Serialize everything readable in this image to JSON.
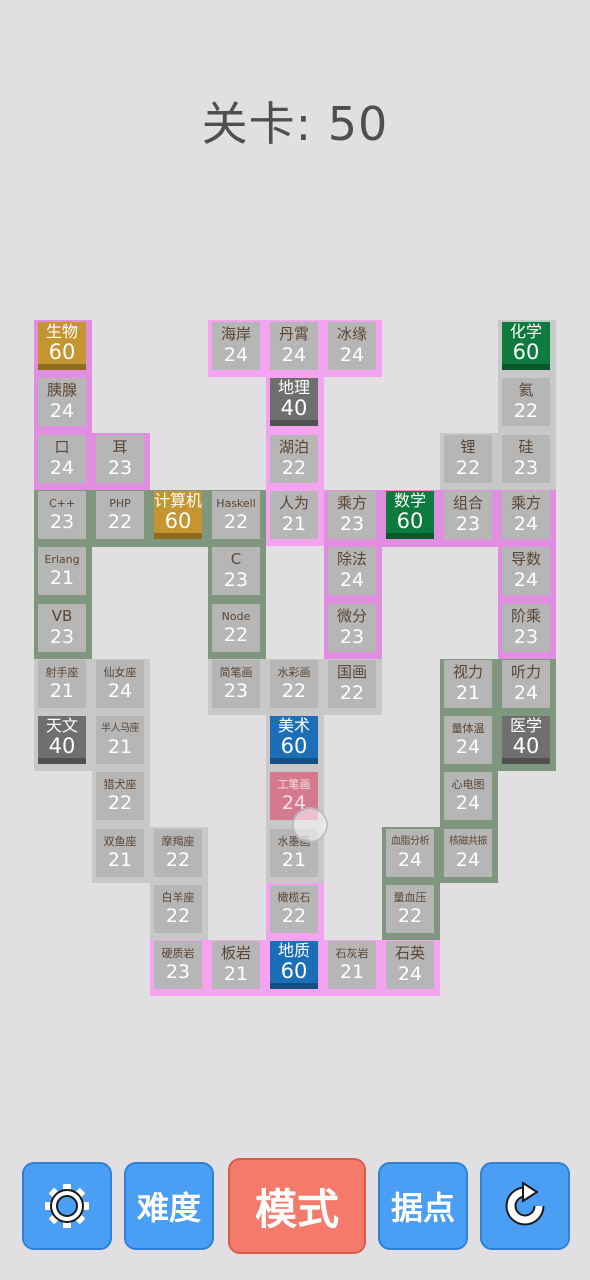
{
  "level": {
    "label": "关卡: 50"
  },
  "colors": {
    "background": "#e1dfe2",
    "tile": "#b6b6b6",
    "pink_region": "#df8ee0",
    "green_region": "#7f977f",
    "light_region": "#c8c8c8",
    "gold": "#c59531",
    "dark_green": "#0d7a3e",
    "blue": "#1c6fb6",
    "gray_big": "#6f6f6f",
    "button": "#4a9ff5",
    "mode_button": "#f47a6c"
  },
  "tiles": [
    {
      "name": "生物",
      "value": "60",
      "col": 0,
      "row": 0,
      "kind": "gold"
    },
    {
      "name": "海岸",
      "value": "24",
      "col": 3,
      "row": 0
    },
    {
      "name": "丹霄",
      "value": "24",
      "col": 4,
      "row": 0
    },
    {
      "name": "冰缘",
      "value": "24",
      "col": 5,
      "row": 0
    },
    {
      "name": "化学",
      "value": "60",
      "col": 8,
      "row": 0,
      "kind": "green"
    },
    {
      "name": "胰腺",
      "value": "24",
      "col": 0,
      "row": 1
    },
    {
      "name": "地理",
      "value": "40",
      "col": 4,
      "row": 1,
      "kind": "gray"
    },
    {
      "name": "氦",
      "value": "22",
      "col": 8,
      "row": 1
    },
    {
      "name": "口",
      "value": "24",
      "col": 0,
      "row": 2
    },
    {
      "name": "耳",
      "value": "23",
      "col": 1,
      "row": 2
    },
    {
      "name": "湖泊",
      "value": "22",
      "col": 4,
      "row": 2
    },
    {
      "name": "锂",
      "value": "22",
      "col": 7,
      "row": 2
    },
    {
      "name": "硅",
      "value": "23",
      "col": 8,
      "row": 2
    },
    {
      "name": "C++",
      "value": "23",
      "col": 0,
      "row": 3,
      "size": "s"
    },
    {
      "name": "PHP",
      "value": "22",
      "col": 1,
      "row": 3,
      "size": "s"
    },
    {
      "name": "计算机",
      "value": "60",
      "col": 2,
      "row": 3,
      "kind": "gold",
      "size": "s"
    },
    {
      "name": "Haskell",
      "value": "22",
      "col": 3,
      "row": 3,
      "size": "s"
    },
    {
      "name": "人为",
      "value": "21",
      "col": 4,
      "row": 3
    },
    {
      "name": "乘方",
      "value": "23",
      "col": 5,
      "row": 3
    },
    {
      "name": "数学",
      "value": "60",
      "col": 6,
      "row": 3,
      "kind": "green"
    },
    {
      "name": "组合",
      "value": "23",
      "col": 7,
      "row": 3
    },
    {
      "name": "乘方",
      "value": "24",
      "col": 8,
      "row": 3
    },
    {
      "name": "Erlang",
      "value": "21",
      "col": 0,
      "row": 4,
      "size": "s"
    },
    {
      "name": "C",
      "value": "23",
      "col": 3,
      "row": 4
    },
    {
      "name": "除法",
      "value": "24",
      "col": 5,
      "row": 4
    },
    {
      "name": "导数",
      "value": "24",
      "col": 8,
      "row": 4
    },
    {
      "name": "VB",
      "value": "23",
      "col": 0,
      "row": 5
    },
    {
      "name": "Node",
      "value": "22",
      "col": 3,
      "row": 5,
      "size": "s"
    },
    {
      "name": "微分",
      "value": "23",
      "col": 5,
      "row": 5
    },
    {
      "name": "阶乘",
      "value": "23",
      "col": 8,
      "row": 5
    },
    {
      "name": "射手座",
      "value": "21",
      "col": 0,
      "row": 6,
      "size": "s"
    },
    {
      "name": "仙女座",
      "value": "24",
      "col": 1,
      "row": 6,
      "size": "s"
    },
    {
      "name": "简笔画",
      "value": "23",
      "col": 3,
      "row": 6,
      "size": "s"
    },
    {
      "name": "水彩画",
      "value": "22",
      "col": 4,
      "row": 6,
      "size": "s"
    },
    {
      "name": "国画",
      "value": "22",
      "col": 5,
      "row": 6
    },
    {
      "name": "视力",
      "value": "21",
      "col": 7,
      "row": 6
    },
    {
      "name": "听力",
      "value": "24",
      "col": 8,
      "row": 6
    },
    {
      "name": "天文",
      "value": "40",
      "col": 0,
      "row": 7,
      "kind": "gray"
    },
    {
      "name": "半人马座",
      "value": "21",
      "col": 1,
      "row": 7,
      "size": "xs"
    },
    {
      "name": "美术",
      "value": "60",
      "col": 4,
      "row": 7,
      "kind": "blue"
    },
    {
      "name": "量体温",
      "value": "24",
      "col": 7,
      "row": 7,
      "size": "s"
    },
    {
      "name": "医学",
      "value": "40",
      "col": 8,
      "row": 7,
      "kind": "gray"
    },
    {
      "name": "猎犬座",
      "value": "22",
      "col": 1,
      "row": 8,
      "size": "s"
    },
    {
      "name": "工笔画",
      "value": "24",
      "col": 4,
      "row": 8,
      "kind": "pinkt",
      "size": "s"
    },
    {
      "name": "心电图",
      "value": "24",
      "col": 7,
      "row": 8,
      "size": "s"
    },
    {
      "name": "双鱼座",
      "value": "21",
      "col": 1,
      "row": 9,
      "size": "s"
    },
    {
      "name": "摩羯座",
      "value": "22",
      "col": 2,
      "row": 9,
      "size": "s"
    },
    {
      "name": "水墨画",
      "value": "21",
      "col": 4,
      "row": 9,
      "size": "s"
    },
    {
      "name": "血脂分析",
      "value": "24",
      "col": 6,
      "row": 9,
      "size": "xs"
    },
    {
      "name": "核磁共振",
      "value": "24",
      "col": 7,
      "row": 9,
      "size": "xs"
    },
    {
      "name": "白羊座",
      "value": "22",
      "col": 2,
      "row": 10,
      "size": "s"
    },
    {
      "name": "橄榄石",
      "value": "22",
      "col": 4,
      "row": 10,
      "size": "s"
    },
    {
      "name": "量血压",
      "value": "22",
      "col": 6,
      "row": 10,
      "size": "s"
    },
    {
      "name": "硬质岩",
      "value": "23",
      "col": 2,
      "row": 11,
      "size": "s"
    },
    {
      "name": "板岩",
      "value": "21",
      "col": 3,
      "row": 11
    },
    {
      "name": "地质",
      "value": "60",
      "col": 4,
      "row": 11,
      "kind": "blue"
    },
    {
      "name": "石灰岩",
      "value": "21",
      "col": 5,
      "row": 11,
      "size": "s"
    },
    {
      "name": "石英",
      "value": "24",
      "col": 6,
      "row": 11
    }
  ],
  "buttons": {
    "settings_icon": "gear-icon",
    "difficulty_label": "难度",
    "mode_label": "模式",
    "stronghold_label": "据点",
    "restart_icon": "refresh-icon"
  }
}
